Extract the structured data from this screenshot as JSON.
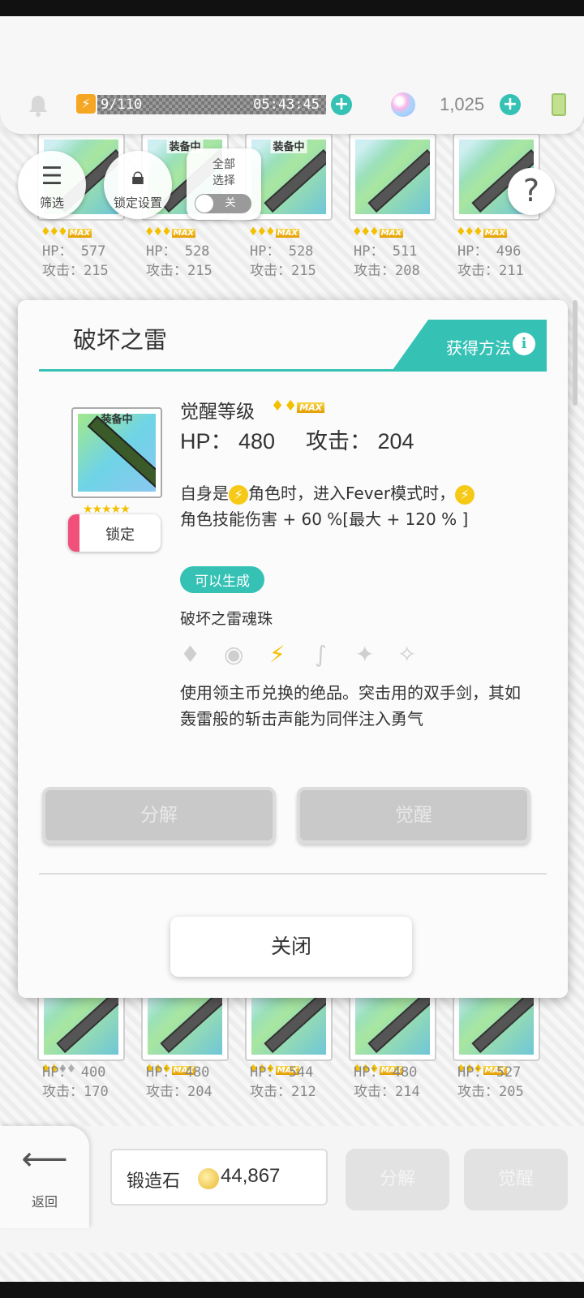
{
  "header": {
    "energy_value": "9/110",
    "energy_timer": "05:43:45",
    "gem_count": "1,025"
  },
  "top_cards": [
    {
      "equipped": "",
      "hp": "HP： 577",
      "atk": "攻击：215",
      "stars": 3,
      "max": true
    },
    {
      "equipped": "装备中",
      "hp": "HP： 528",
      "atk": "攻击：215",
      "stars": 3,
      "max": true
    },
    {
      "equipped": "装备中",
      "hp": "HP： 528",
      "atk": "攻击：215",
      "stars": 3,
      "max": true
    },
    {
      "equipped": "",
      "hp": "HP： 511",
      "atk": "攻击：208",
      "stars": 3,
      "max": true
    },
    {
      "equipped": "",
      "hp": "HP： 496",
      "atk": "攻击：211",
      "stars": 3,
      "max": true
    }
  ],
  "bottom_cards": [
    {
      "hp": "HP： 400",
      "atk": "攻击：170",
      "stars": 2,
      "max": false
    },
    {
      "hp": "HP： 480",
      "atk": "攻击：204",
      "stars": 3,
      "max": true
    },
    {
      "hp": "HP： 544",
      "atk": "攻击：212",
      "stars": 3,
      "max": true
    },
    {
      "hp": "HP： 480",
      "atk": "攻击：214",
      "stars": 3,
      "max": true
    },
    {
      "hp": "HP： 527",
      "atk": "攻击：205",
      "stars": 3,
      "max": true
    }
  ],
  "toolbar": {
    "filter_label": "筛选",
    "lock_settings_label": "锁定设置",
    "select_all_label_1": "全部",
    "select_all_label_2": "选择",
    "toggle_label": "关"
  },
  "modal": {
    "title": "破坏之雷",
    "obtain_label": "获得方法",
    "equipped_label": "装备中",
    "lock_label": "锁定",
    "awaken_label": "觉醒等级",
    "max_label": "MAX",
    "hp": "HP： 480",
    "atk": "攻击： 204",
    "skill_line1_a": "自身是",
    "skill_line1_b": "角色时，进入Fever模式时，",
    "skill_line2": "角色技能伤害 + 60 %[最大 + 120 % ]",
    "badge": "可以生成",
    "orb_name": "破坏之雷魂珠",
    "description": "使用领主币兑换的绝品。突击用的双手剑，其如轰雷般的斩击声能为同伴注入勇气",
    "decompose_label": "分解",
    "awaken_button_label": "觉醒",
    "close_label": "关闭"
  },
  "footer": {
    "back_label": "返回",
    "forge_label": "锻造石",
    "forge_value": "44,867",
    "decompose_label": "分解",
    "awaken_label": "觉醒"
  },
  "colors": {
    "accent": "#35c2b5",
    "lock_accent": "#f0507a",
    "gold": "#f3c000"
  }
}
